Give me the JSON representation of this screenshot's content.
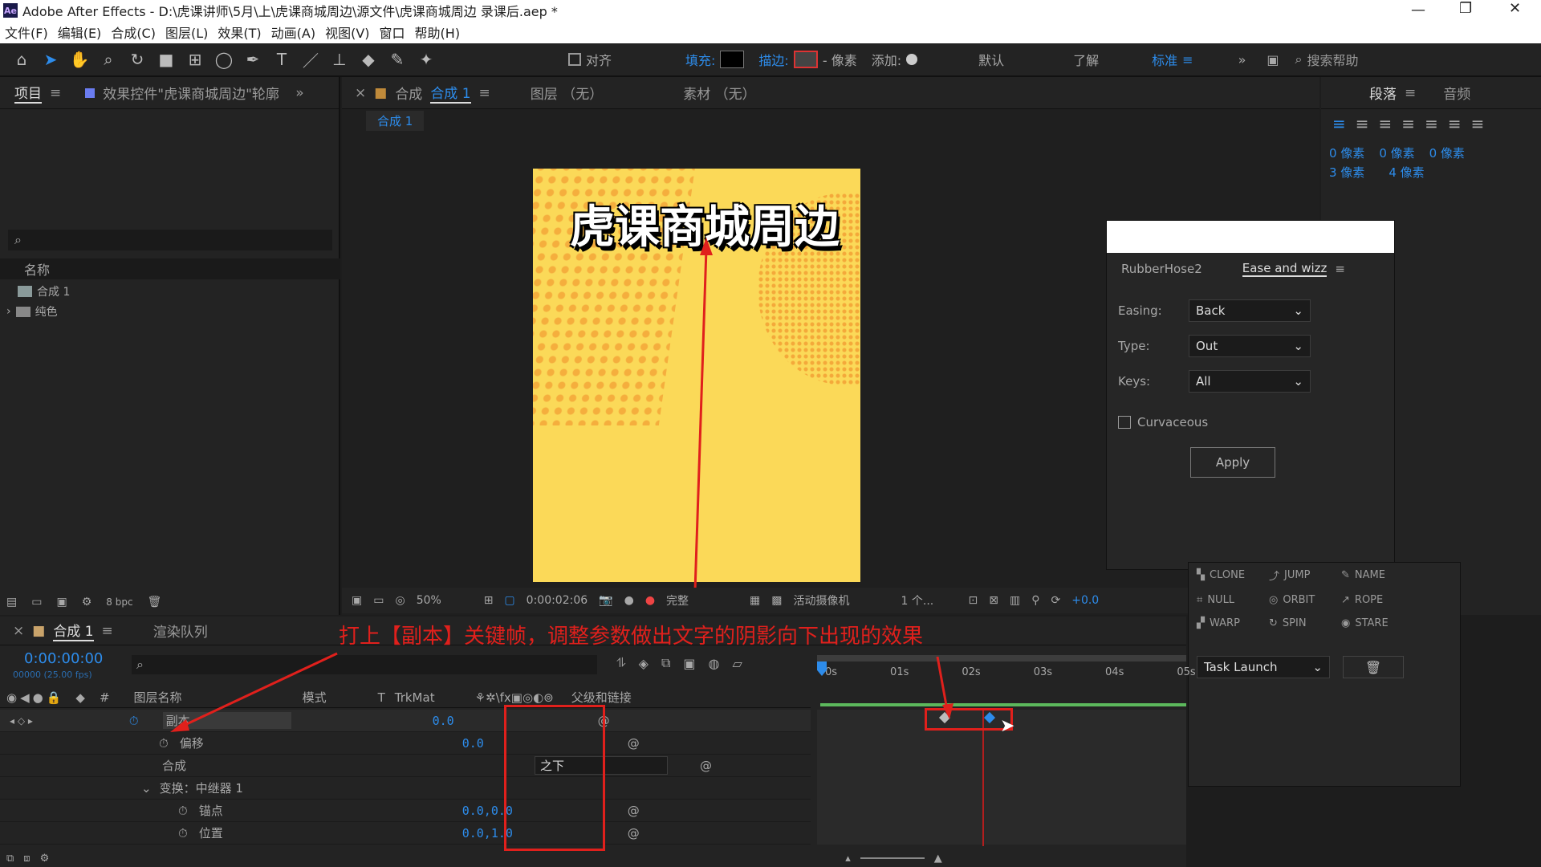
{
  "window": {
    "title": "Adobe After Effects - D:\\虎课讲师\\5月\\上\\虎课商城周边\\源文件\\虎课商城周边 录课后.aep *",
    "app_icon": "Ae"
  },
  "menu": [
    "文件(F)",
    "编辑(E)",
    "合成(C)",
    "图层(L)",
    "效果(T)",
    "动画(A)",
    "视图(V)",
    "窗口",
    "帮助(H)"
  ],
  "toolbar": {
    "align": "对齐",
    "fill_label": "填充:",
    "stroke_label": "描边:",
    "pixels": "- 像素",
    "add_label": "添加:",
    "ws_default": "默认",
    "ws_learn": "了解",
    "ws_standard": "标准",
    "search_placeholder": "搜索帮助"
  },
  "project": {
    "tab": "项目",
    "effect_tab": "效果控件\"虎课商城周边\"轮廓",
    "col_name": "名称",
    "items": [
      {
        "name": "合成 1",
        "icon": "composition-icon"
      },
      {
        "name": "纯色",
        "icon": "folder-icon"
      }
    ],
    "bpc": "8 bpc"
  },
  "comp": {
    "tab_label": "合成",
    "tab_name": "合成 1",
    "layer_tab": "图层 （无）",
    "footage_tab": "素材 （无）",
    "crumb": "合成 1",
    "poster_title": "虎课商城周边",
    "zoom": "50%",
    "timecode": "0:00:02:06",
    "quality": "完整",
    "camera": "活动摄像机",
    "views": "1 个...",
    "exposure": "+0.0"
  },
  "paragraph": {
    "tab": "段落",
    "audio_tab": "音频",
    "indent1": "0 像素",
    "indent2": "0 像素",
    "indent3": "0 像素",
    "space1": "3 像素",
    "space2": "4 像素"
  },
  "ease": {
    "tab1": "RubberHose2",
    "tab2": "Ease and wizz",
    "easing_label": "Easing:",
    "easing_value": "Back",
    "type_label": "Type:",
    "type_value": "Out",
    "keys_label": "Keys:",
    "keys_value": "All",
    "curvaceous": "Curvaceous",
    "apply": "Apply"
  },
  "rubberhose": {
    "buttons": [
      "CLONE",
      "JUMP",
      "NAME",
      "NULL",
      "ORBIT",
      "ROPE",
      "WARP",
      "SPIN",
      "STARE"
    ],
    "task": "Task Launch"
  },
  "timeline": {
    "tab": "合成 1",
    "render_tab": "渲染队列",
    "timecode": "0:00:00:00",
    "frames": "00000 (25.00 fps)",
    "annotation": "打上【副本】关键帧，调整参数做出文字的阴影向下出现的效果",
    "col_layer": "图层名称",
    "col_mode": "模式",
    "col_t": "T",
    "col_trkmat": "TrkMat",
    "col_parent": "父级和链接",
    "ruler": [
      "0s",
      "01s",
      "02s",
      "03s",
      "04s",
      "05s"
    ],
    "rows": [
      {
        "name": "副本",
        "value": "0.0"
      },
      {
        "name": "偏移",
        "value": "0.0"
      },
      {
        "name": "合成",
        "value": "之下"
      },
      {
        "name": "变换：中继器 1",
        "value": ""
      },
      {
        "name": "锚点",
        "value": "0.0,0.0"
      },
      {
        "name": "位置",
        "value": "0.0,1.0"
      }
    ]
  },
  "colors": {
    "accent": "#2d8ceb",
    "annotation": "#e0201c",
    "poster_bg": "#fbd958",
    "poster_dots": "#f4a93a"
  }
}
